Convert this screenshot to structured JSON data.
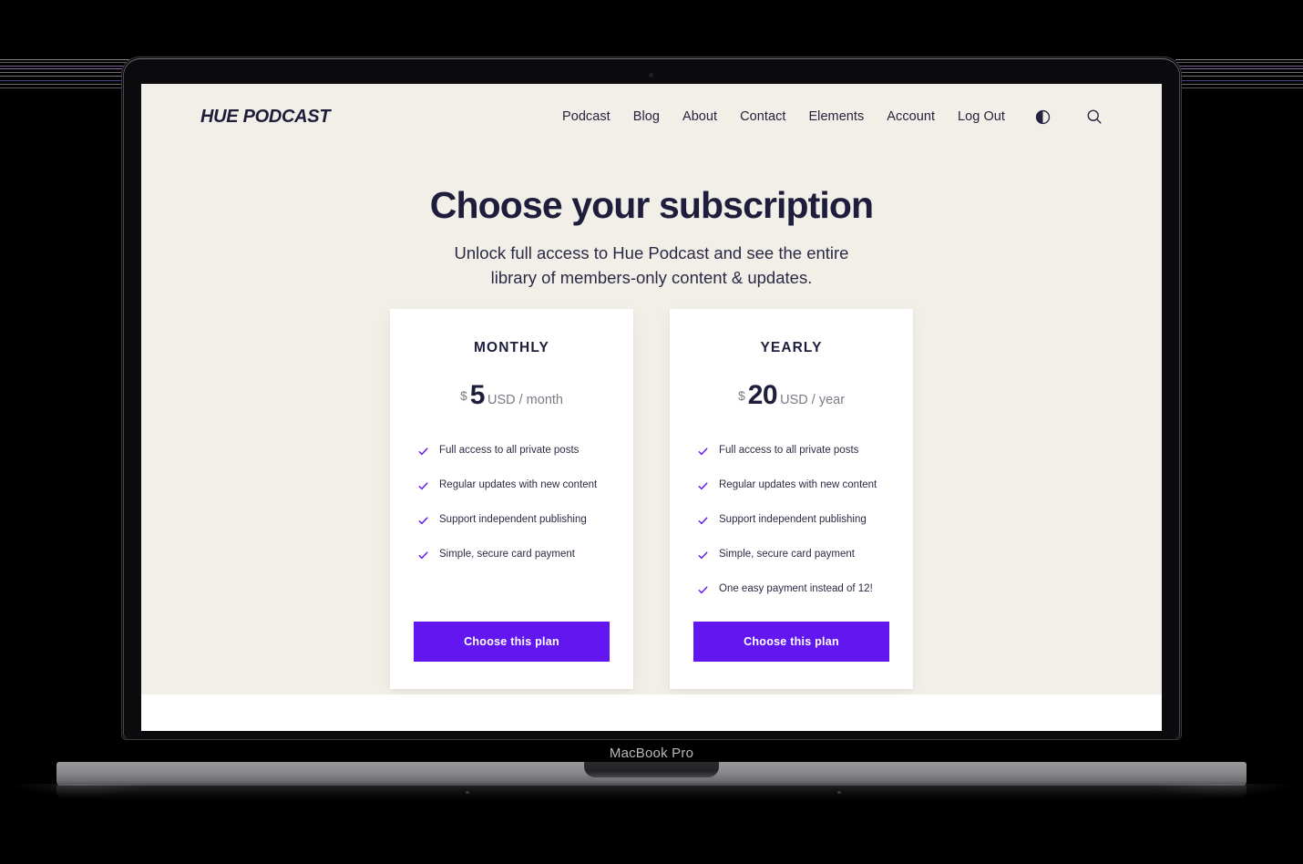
{
  "device": {
    "model_label": "MacBook Pro"
  },
  "site": {
    "logo": "HUE PODCAST",
    "nav": [
      {
        "label": "Podcast"
      },
      {
        "label": "Blog"
      },
      {
        "label": "About"
      },
      {
        "label": "Contact"
      },
      {
        "label": "Elements"
      },
      {
        "label": "Account"
      },
      {
        "label": "Log Out"
      }
    ],
    "theme_toggle_icon": "half-circle-contrast-icon",
    "search_icon": "search-icon"
  },
  "hero": {
    "title": "Choose your subscription",
    "subtitle": "Unlock full access to Hue Podcast and see the entire library of members-only content & updates."
  },
  "plans": [
    {
      "name": "MONTHLY",
      "currency": "$",
      "amount": "5",
      "period": "USD / month",
      "features": [
        "Full access to all private posts",
        "Regular updates with new content",
        "Support independent publishing",
        "Simple, secure card payment"
      ],
      "cta": "Choose this plan"
    },
    {
      "name": "YEARLY",
      "currency": "$",
      "amount": "20",
      "period": "USD / year",
      "features": [
        "Full access to all private posts",
        "Regular updates with new content",
        "Support independent publishing",
        "Simple, secure card payment",
        "One easy payment instead of 12!"
      ],
      "cta": "Choose this plan"
    }
  ],
  "colors": {
    "page_background": "#f2efe8",
    "ink": "#1e1e3c",
    "accent_purple": "#6216f0",
    "muted": "#7b7b86",
    "card_background": "#ffffff"
  }
}
